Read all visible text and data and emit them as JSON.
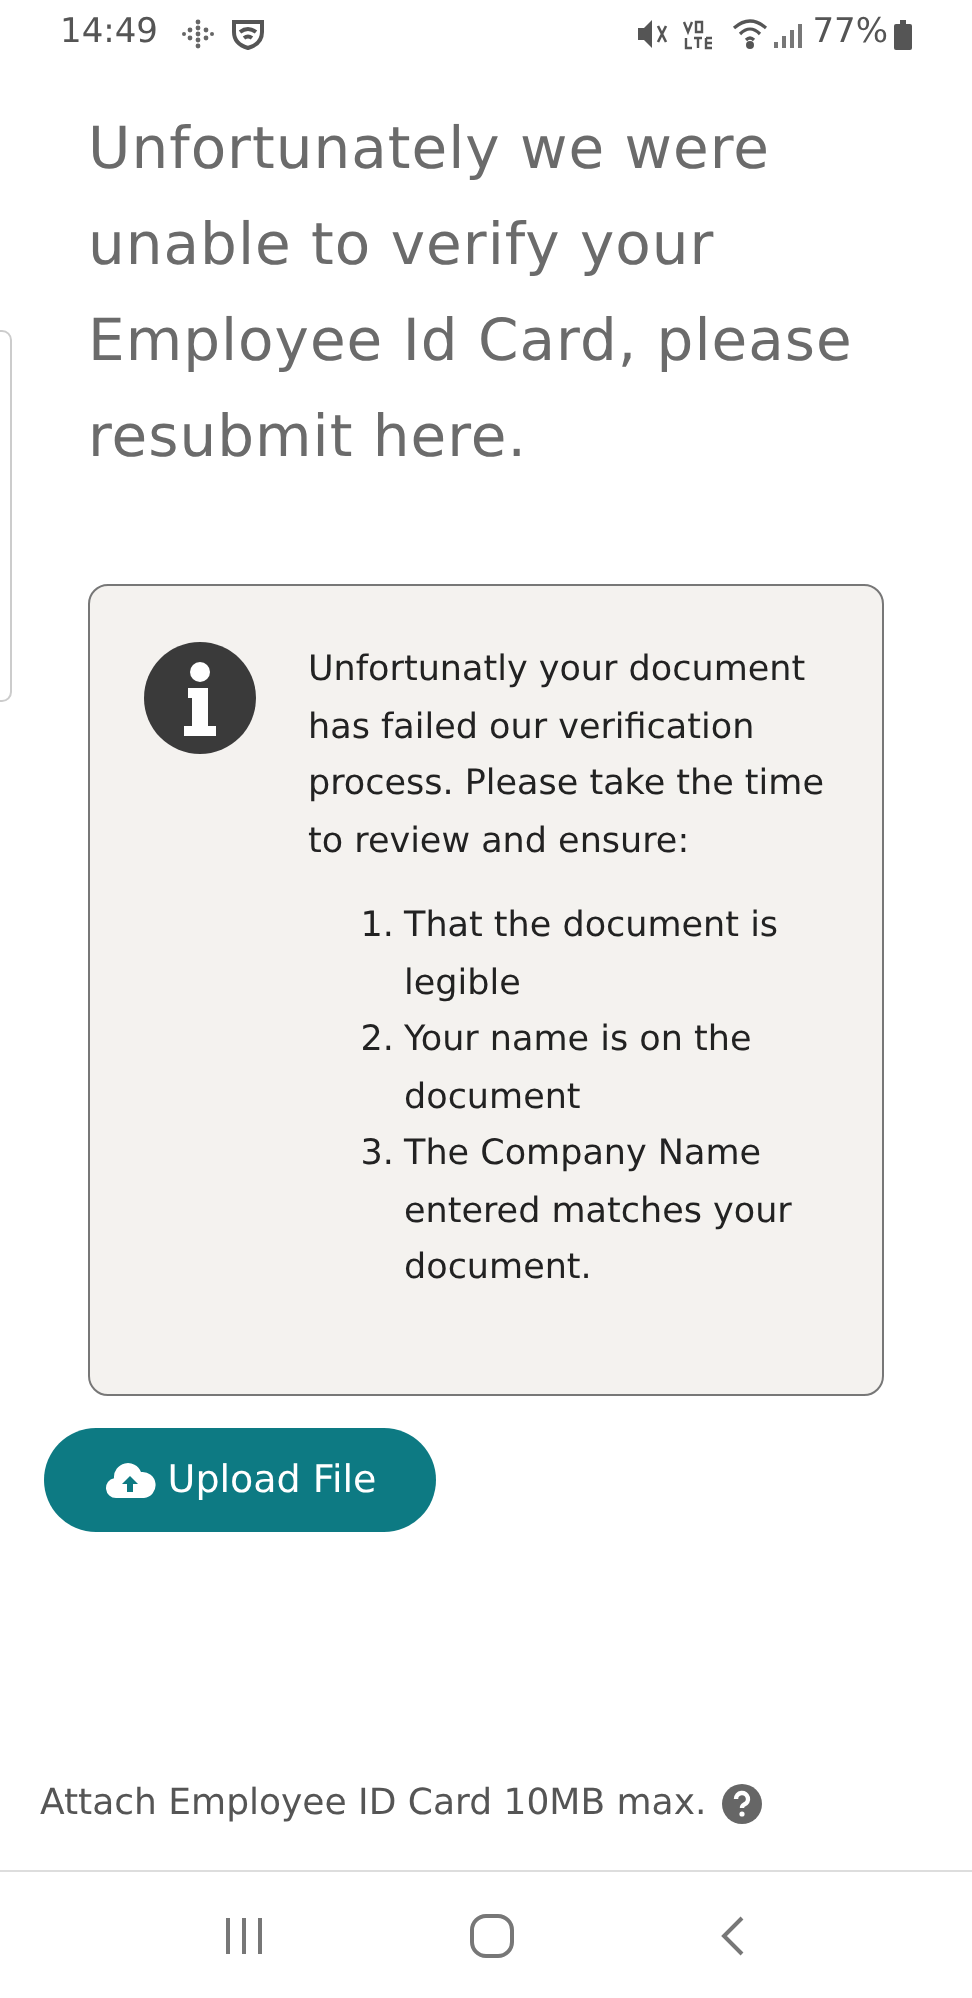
{
  "status_bar": {
    "time": "14:49",
    "battery": "77%"
  },
  "heading": "Unfortunately we were unable to verify your Employee Id Card, please resubmit here.",
  "notice": {
    "message": "Unfortunatly your document has failed our verification process. Please take the time to review and ensure:",
    "items": [
      {
        "number": "1.",
        "text": "That the document is legible"
      },
      {
        "number": "2.",
        "text": "Your name is on the document"
      },
      {
        "number": "3.",
        "text": "The Company Name entered matches your document."
      }
    ]
  },
  "upload_button": "Upload File",
  "hint": "Attach Employee ID Card 10MB max."
}
